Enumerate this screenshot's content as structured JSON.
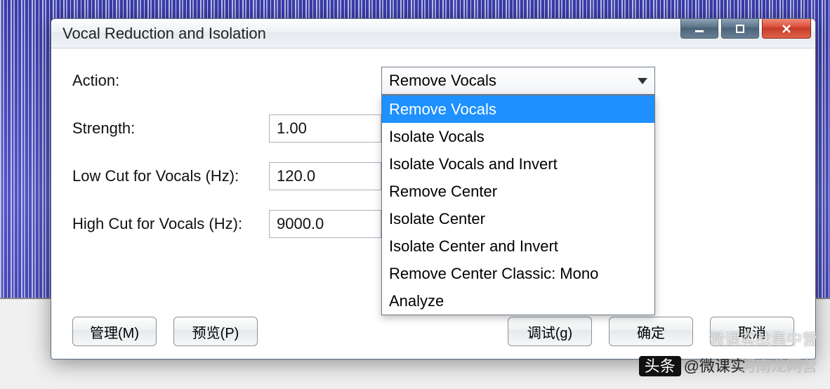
{
  "window": {
    "title": "Vocal Reduction and Isolation"
  },
  "fields": {
    "action_label": "Action:",
    "strength_label": "Strength:",
    "strength_value": "1.00",
    "lowcut_label": "Low Cut for Vocals (Hz):",
    "lowcut_value": "120.0",
    "highcut_label": "High Cut for Vocals (Hz):",
    "highcut_value": "9000.0"
  },
  "action": {
    "selected": "Remove Vocals",
    "options": [
      "Remove Vocals",
      "Isolate Vocals",
      "Isolate Vocals and Invert",
      "Remove Center",
      "Isolate Center",
      "Isolate Center and Invert",
      "Remove Center Classic: Mono",
      "Analyze"
    ]
  },
  "buttons": {
    "manage": "管理(M)",
    "preview": "预览(P)",
    "debug": "调试(g)",
    "ok": "确定",
    "cancel": "取消"
  },
  "watermarks": {
    "top": "微课实战集中营",
    "prefix": "头条",
    "handle": "@微课实",
    "site": "河南龙网营"
  }
}
